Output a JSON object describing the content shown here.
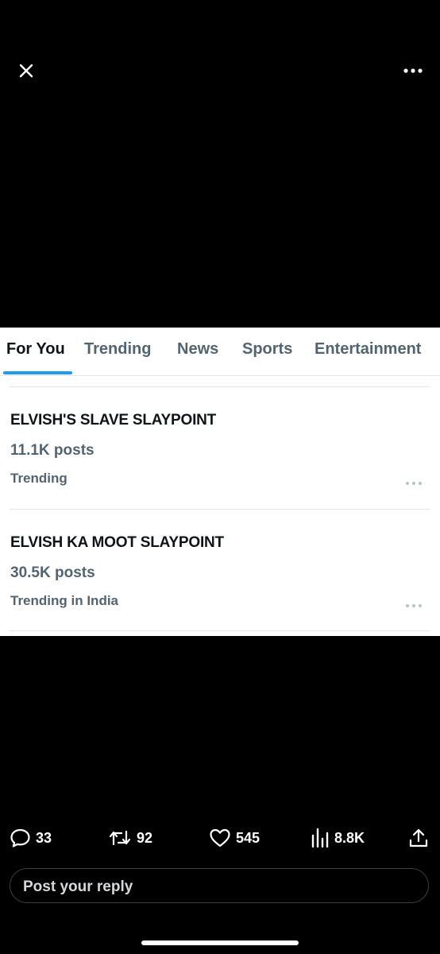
{
  "tabs": [
    {
      "label": "For You"
    },
    {
      "label": "Trending"
    },
    {
      "label": "News"
    },
    {
      "label": "Sports"
    },
    {
      "label": "Entertainment"
    }
  ],
  "active_tab": "For You",
  "trends": [
    {
      "title": "ELVISH'S SLAVE SLAYPOINT",
      "posts": "11.1K posts",
      "context": "Trending"
    },
    {
      "title": "ELVISH KA MOOT SLAYPOINT",
      "posts": "30.5K posts",
      "context": "Trending in India"
    }
  ],
  "actions": {
    "replies": "33",
    "reposts": "92",
    "likes": "545",
    "views": "8.8K"
  },
  "reply": {
    "placeholder": "Post your reply"
  },
  "colors": {
    "accent": "#1d9bf0",
    "muted_text": "#536471",
    "background": "#000000"
  }
}
